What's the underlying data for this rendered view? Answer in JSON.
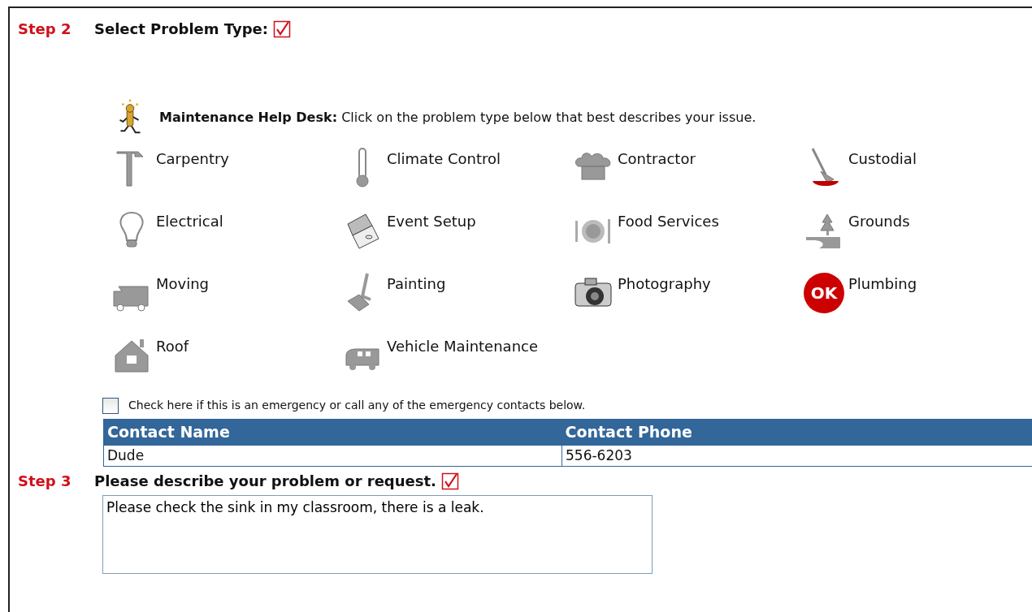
{
  "step2": {
    "step_label": "Step 2",
    "title": "Select Problem Type:",
    "checked": true
  },
  "help_desk": {
    "title": "Maintenance Help Desk:",
    "instruction": "Click on the problem type below that best describes your issue."
  },
  "problem_types": [
    {
      "label": "Carpentry",
      "selected": false
    },
    {
      "label": "Climate Control",
      "selected": false
    },
    {
      "label": "Contractor",
      "selected": false
    },
    {
      "label": "Custodial",
      "selected": false
    },
    {
      "label": "Electrical",
      "selected": false
    },
    {
      "label": "Event Setup",
      "selected": false
    },
    {
      "label": "Food Services",
      "selected": false
    },
    {
      "label": "Grounds",
      "selected": false
    },
    {
      "label": "Moving",
      "selected": false
    },
    {
      "label": "Painting",
      "selected": false
    },
    {
      "label": "Photography",
      "selected": false
    },
    {
      "label": "Plumbing",
      "selected": true,
      "badge": "OK"
    },
    {
      "label": "Roof",
      "selected": false
    },
    {
      "label": "Vehicle Maintenance",
      "selected": false
    }
  ],
  "emergency": {
    "label": "Check here if this is an emergency or call any of the emergency contacts below.",
    "checked": false
  },
  "contacts": {
    "columns": [
      "Contact Name",
      "Contact Phone"
    ],
    "rows": [
      [
        "Dude",
        "556-6203"
      ]
    ]
  },
  "step3": {
    "step_label": "Step 3",
    "title": "Please describe your problem or request.",
    "checked": true
  },
  "description": {
    "value": "Please check the sink in my classroom, there is a leak."
  }
}
